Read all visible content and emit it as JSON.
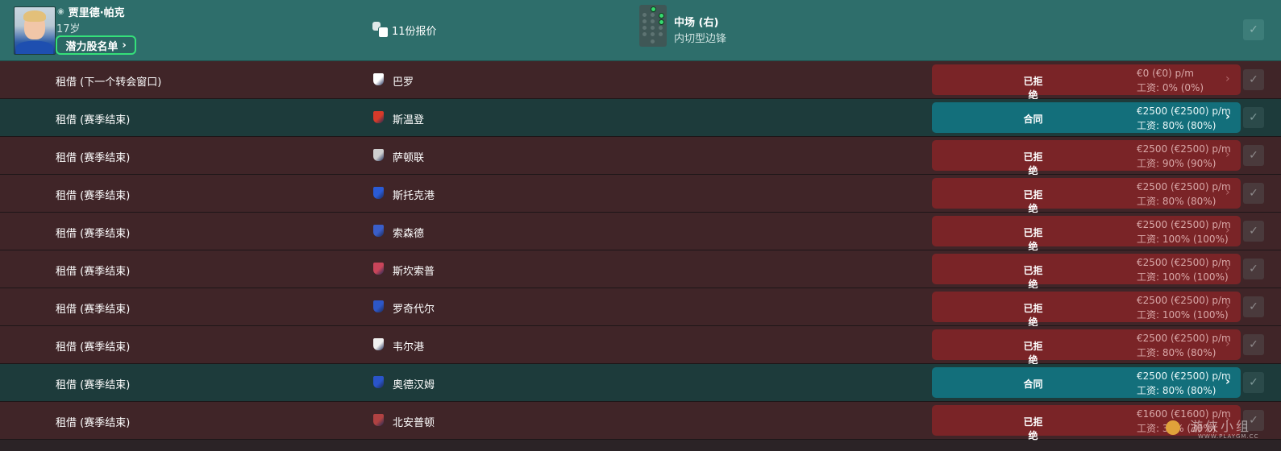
{
  "player": {
    "name": "贾里德·帕克",
    "age": "17岁",
    "shortlist_label": "潜力股名单",
    "offers_label": "11份报价",
    "position": "中场 (右)",
    "role": "内切型边锋"
  },
  "offers": [
    {
      "deal_type": "租借 (下一个转会窗口)",
      "club": "巴罗",
      "status": "已拒绝",
      "fee": "€0 (€0) p/m",
      "wage": "工资: 0% (0%)",
      "accepted": false,
      "club_color": "#ffffff"
    },
    {
      "deal_type": "租借 (赛季结束)",
      "club": "斯温登",
      "status": "合同",
      "fee": "€2500 (€2500) p/m",
      "wage": "工资: 80% (80%)",
      "accepted": true,
      "club_color": "#d63a2a"
    },
    {
      "deal_type": "租借 (赛季结束)",
      "club": "萨顿联",
      "status": "已拒绝",
      "fee": "€2500 (€2500) p/m",
      "wage": "工资: 90% (90%)",
      "accepted": false,
      "club_color": "#cfcfcf"
    },
    {
      "deal_type": "租借 (赛季结束)",
      "club": "斯托克港",
      "status": "已拒绝",
      "fee": "€2500 (€2500) p/m",
      "wage": "工资: 80% (80%)",
      "accepted": false,
      "club_color": "#2a5bd6"
    },
    {
      "deal_type": "租借 (赛季结束)",
      "club": "索森德",
      "status": "已拒绝",
      "fee": "€2500 (€2500) p/m",
      "wage": "工资: 100% (100%)",
      "accepted": false,
      "club_color": "#3a5ec9"
    },
    {
      "deal_type": "租借 (赛季结束)",
      "club": "斯坎索普",
      "status": "已拒绝",
      "fee": "€2500 (€2500) p/m",
      "wage": "工资: 100% (100%)",
      "accepted": false,
      "club_color": "#c9455a"
    },
    {
      "deal_type": "租借 (赛季结束)",
      "club": "罗奇代尔",
      "status": "已拒绝",
      "fee": "€2500 (€2500) p/m",
      "wage": "工资: 100% (100%)",
      "accepted": false,
      "club_color": "#2d57c7"
    },
    {
      "deal_type": "租借 (赛季结束)",
      "club": "韦尔港",
      "status": "已拒绝",
      "fee": "€2500 (€2500) p/m",
      "wage": "工资: 80% (80%)",
      "accepted": false,
      "club_color": "#f0f0f0"
    },
    {
      "deal_type": "租借 (赛季结束)",
      "club": "奥德汉姆",
      "status": "合同",
      "fee": "€2500 (€2500) p/m",
      "wage": "工资: 80% (80%)",
      "accepted": true,
      "club_color": "#2a54c9"
    },
    {
      "deal_type": "租借 (赛季结束)",
      "club": "北安普顿",
      "status": "已拒绝",
      "fee": "€1600 (€1600) p/m",
      "wage": "工资: 30% (30%)",
      "accepted": false,
      "club_color": "#b04242"
    }
  ],
  "watermark": {
    "text": "游侠小组",
    "url": "WWW.PLAYGM.CC"
  },
  "icons": {
    "person": "person-icon",
    "offers": "speech-bubbles-icon",
    "check": "check-icon",
    "chevron": "chevron-right-icon"
  }
}
